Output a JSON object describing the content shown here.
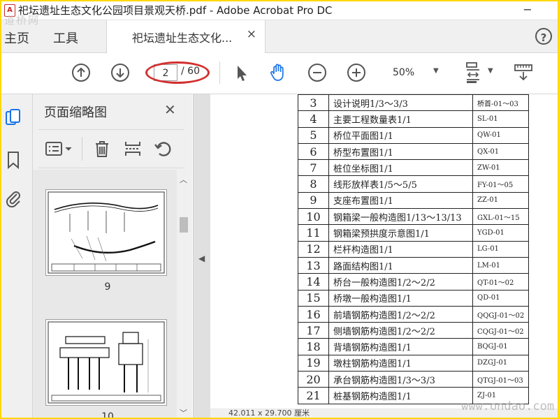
{
  "window": {
    "title": "祀坛遗址生态文化公园项目景观天桥.pdf - Adobe Acrobat Pro DC"
  },
  "tabs": {
    "home": "主页",
    "tools": "工具",
    "document": "祀坛遗址生态文化...",
    "close": "×"
  },
  "toolbar": {
    "current_page": "2",
    "total_pages": "/ 60",
    "zoom": "50%"
  },
  "thumbnails": {
    "title": "页面缩略图",
    "items": [
      {
        "label": "9"
      },
      {
        "label": "10"
      }
    ]
  },
  "drawing_list": {
    "rows": [
      {
        "no": "3",
        "name": "设计说明1/3～3/3",
        "code": "桥首-01～03"
      },
      {
        "no": "4",
        "name": "主要工程数量表1/1",
        "code": "SL-01"
      },
      {
        "no": "5",
        "name": "桥位平面图1/1",
        "code": "QW-01"
      },
      {
        "no": "6",
        "name": "桥型布置图1/1",
        "code": "QX-01"
      },
      {
        "no": "7",
        "name": "桩位坐标图1/1",
        "code": "ZW-01"
      },
      {
        "no": "8",
        "name": "线形放样表1/5～5/5",
        "code": "FY-01～05"
      },
      {
        "no": "9",
        "name": "支座布置图1/1",
        "code": "ZZ-01"
      },
      {
        "no": "10",
        "name": "钢箱梁一般构造图1/13～13/13",
        "code": "GXL-01～15"
      },
      {
        "no": "11",
        "name": "钢箱梁预拱度示意图1/1",
        "code": "YGD-01"
      },
      {
        "no": "12",
        "name": "栏杆构造图1/1",
        "code": "LG-01"
      },
      {
        "no": "13",
        "name": "路面结构图1/1",
        "code": "LM-01"
      },
      {
        "no": "14",
        "name": "桥台一般构造图1/2～2/2",
        "code": "QT-01～02"
      },
      {
        "no": "15",
        "name": "桥墩一般构造图1/1",
        "code": "QD-01"
      },
      {
        "no": "16",
        "name": "前墙钢筋构造图1/2～2/2",
        "code": "QQGJ-01～02"
      },
      {
        "no": "17",
        "name": "侧墙钢筋构造图1/2～2/2",
        "code": "CQGJ-01～02"
      },
      {
        "no": "18",
        "name": "背墙钢筋构造图1/1",
        "code": "BQGJ-01"
      },
      {
        "no": "19",
        "name": "墩柱钢筋构造图1/1",
        "code": "DZGJ-01"
      },
      {
        "no": "20",
        "name": "承台钢筋构造图1/3～3/3",
        "code": "QTGJ-01～03"
      },
      {
        "no": "21",
        "name": "桩基钢筋构造图1/1",
        "code": "ZJ-01"
      }
    ]
  },
  "status": {
    "page_size": "42.011 x 29.700 厘米"
  },
  "watermarks": {
    "top": "道桥网",
    "bottom": "www.ondao.com"
  },
  "colors": {
    "annotation_ellipse": "#d32f2f",
    "frame": "#ffd800",
    "hand_tool_active": "#1a73e8"
  }
}
